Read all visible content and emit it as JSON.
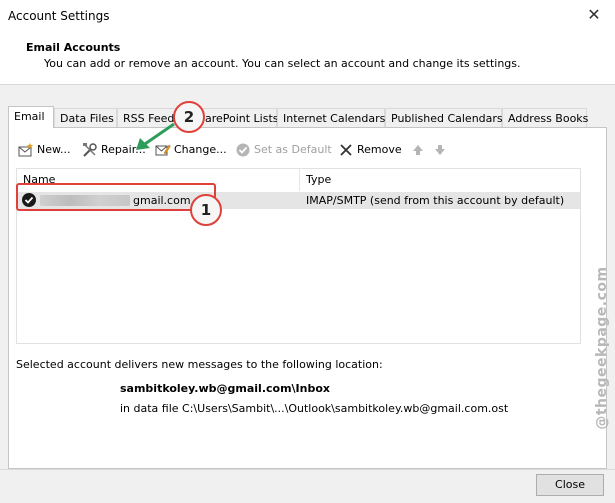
{
  "window": {
    "title": "Account Settings",
    "close_glyph": "✕"
  },
  "header": {
    "heading": "Email Accounts",
    "subtext": "You can add or remove an account. You can select an account and change its settings."
  },
  "tabs": [
    {
      "label": "Email",
      "active": true
    },
    {
      "label": "Data Files"
    },
    {
      "label": "RSS Feeds"
    },
    {
      "label": "SharePoint Lists"
    },
    {
      "label": "Internet Calendars"
    },
    {
      "label": "Published Calendars"
    },
    {
      "label": "Address Books"
    }
  ],
  "toolbar": {
    "new_label": "New...",
    "repair_label": "Repair...",
    "change_label": "Change...",
    "set_default_label": "Set as Default",
    "remove_label": "Remove"
  },
  "list": {
    "columns": [
      "Name",
      "Type"
    ],
    "rows": [
      {
        "name": "gmail.com",
        "type": "IMAP/SMTP (send from this account by default)"
      }
    ]
  },
  "info": {
    "delivery_text": "Selected account delivers new messages to the following location:",
    "folder": "sambitkoley.wb@gmail.com\\Inbox",
    "data_file": "in data file C:\\Users\\Sambit\\...\\Outlook\\sambitkoley.wb@gmail.com.ost"
  },
  "callouts": [
    "1",
    "2"
  ],
  "footer": {
    "close_label": "Close"
  },
  "watermark": "@thegeekpage.com",
  "colors": {
    "callout_border": "#e0403a",
    "arrow": "#2e9c5a",
    "selected_row": "#e5e5e5"
  }
}
